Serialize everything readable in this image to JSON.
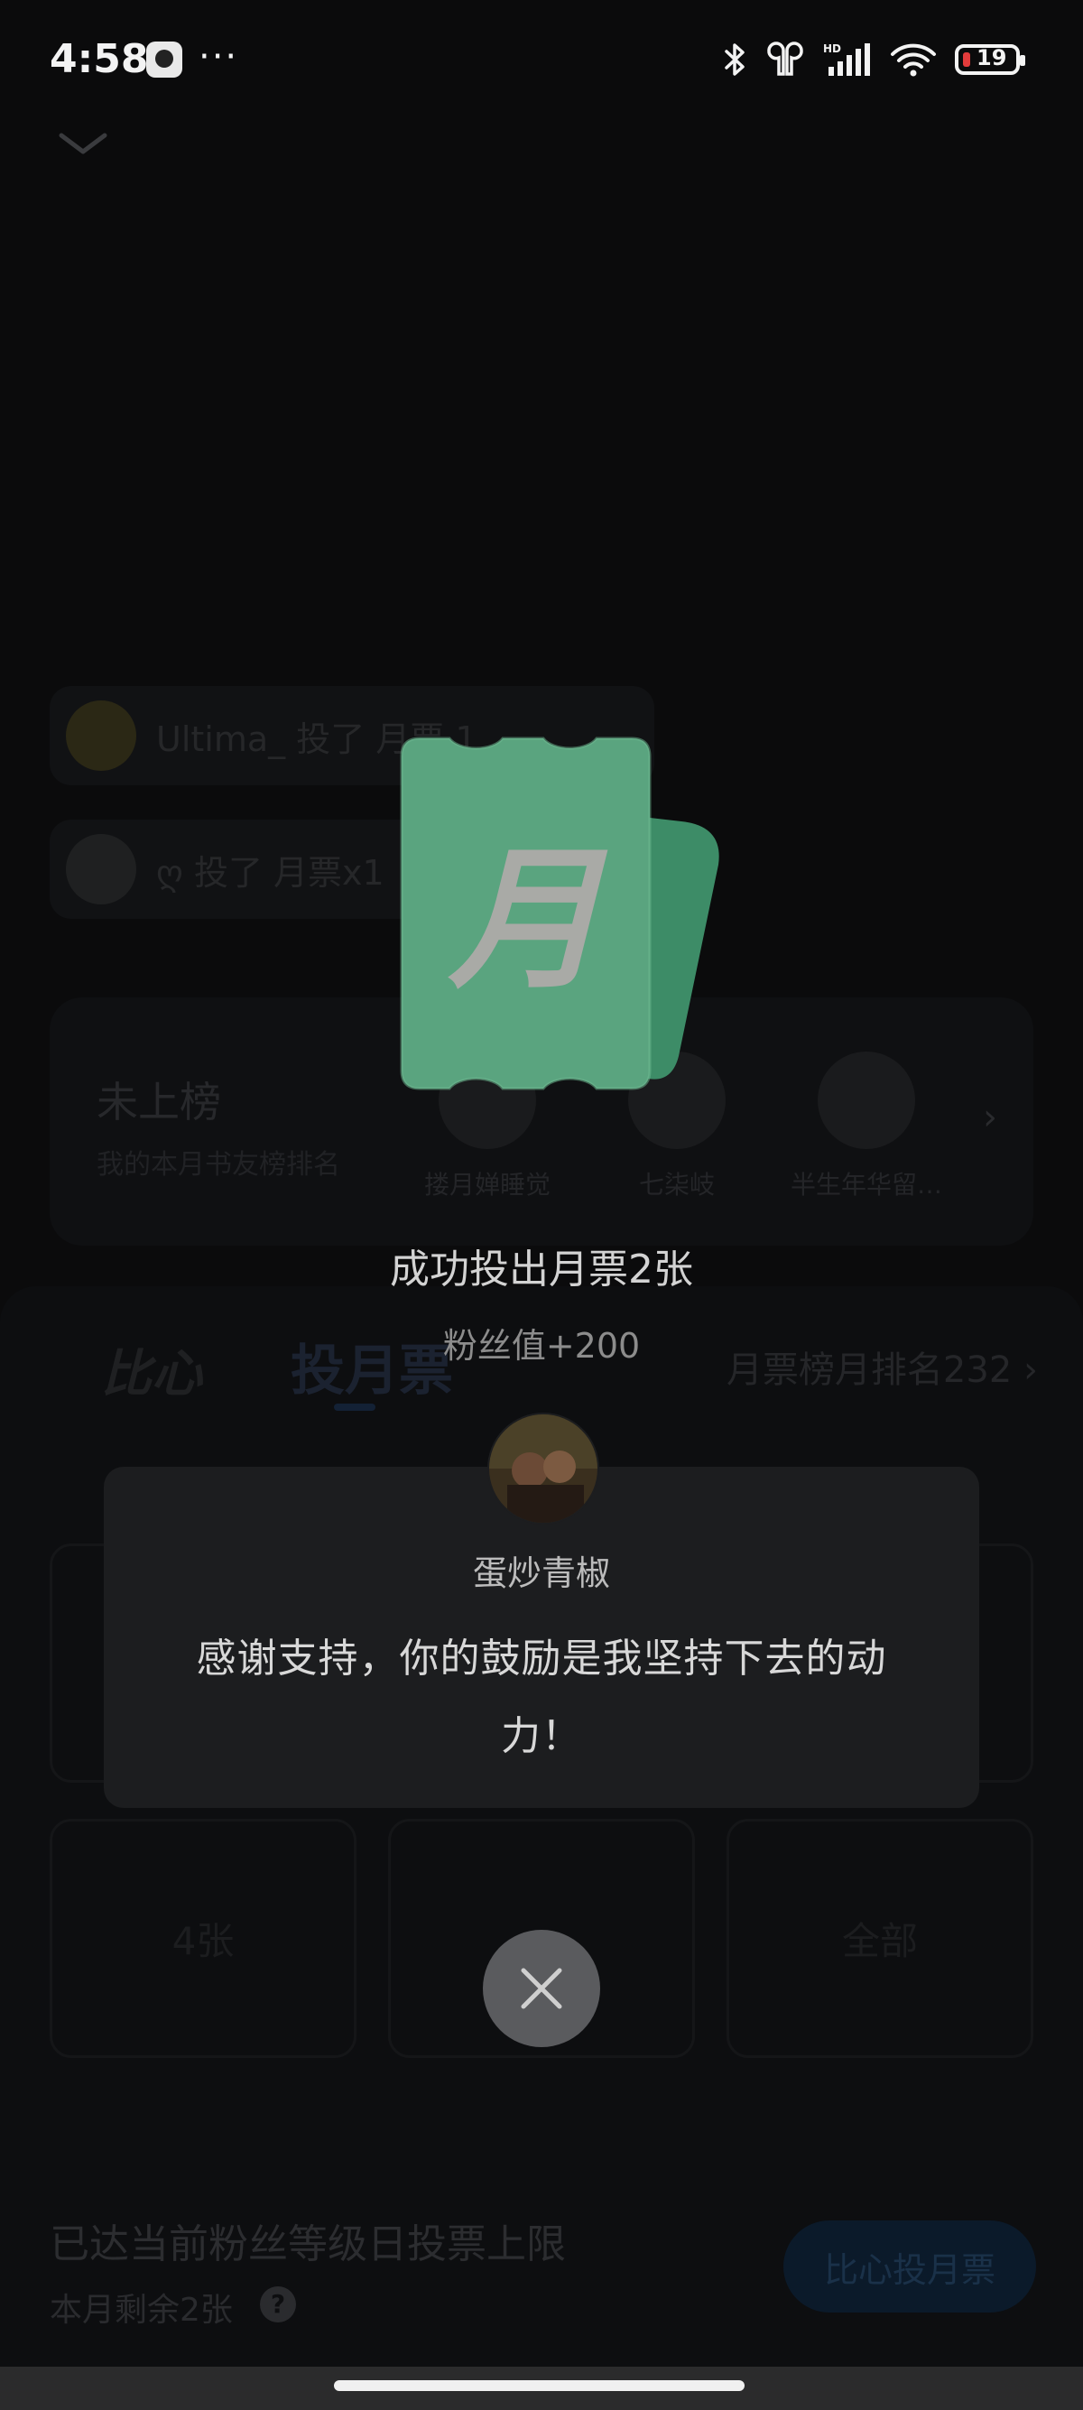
{
  "status_bar": {
    "time": "4:58",
    "dots": "···",
    "battery": "19",
    "icons": [
      "bluetooth-icon",
      "earbuds-icon",
      "hd-signal-icon",
      "wifi-icon",
      "battery-icon"
    ]
  },
  "feed": [
    {
      "text": "Ultima_ 投了 月票 1"
    },
    {
      "text": "ღ 投了 月票x1"
    }
  ],
  "rank_card": {
    "title": "未上榜",
    "subtitle": "我的本月书友榜排名",
    "fans": [
      {
        "name": "搂月婵睡觉"
      },
      {
        "name": "七柒岐"
      },
      {
        "name": "半生年华留…"
      }
    ]
  },
  "vote_panel": {
    "tab_bixin": "比心",
    "tab_vote": "投月票",
    "rank_link": "月票榜月排名232",
    "options": [
      "",
      "",
      "",
      "4张",
      "",
      "全部"
    ],
    "limit_text": "已达当前粉丝等级日投票上限",
    "remaining_text": "本月剩余2张",
    "help_glyph": "?",
    "vote_button": "比心投月票"
  },
  "overlay": {
    "ticket_glyph": "月",
    "success_title": "成功投出月票2张",
    "fan_value": "粉丝值+200",
    "author_name": "蛋炒青椒",
    "thank_message": "感谢支持，你的鼓励是我坚持下去的动力！"
  },
  "colors": {
    "ticket_green": "#5aa47f",
    "ticket_dark_green": "#3d8c67",
    "close_button": "#5a5b5e",
    "card_bg": "#1c1d1f"
  }
}
